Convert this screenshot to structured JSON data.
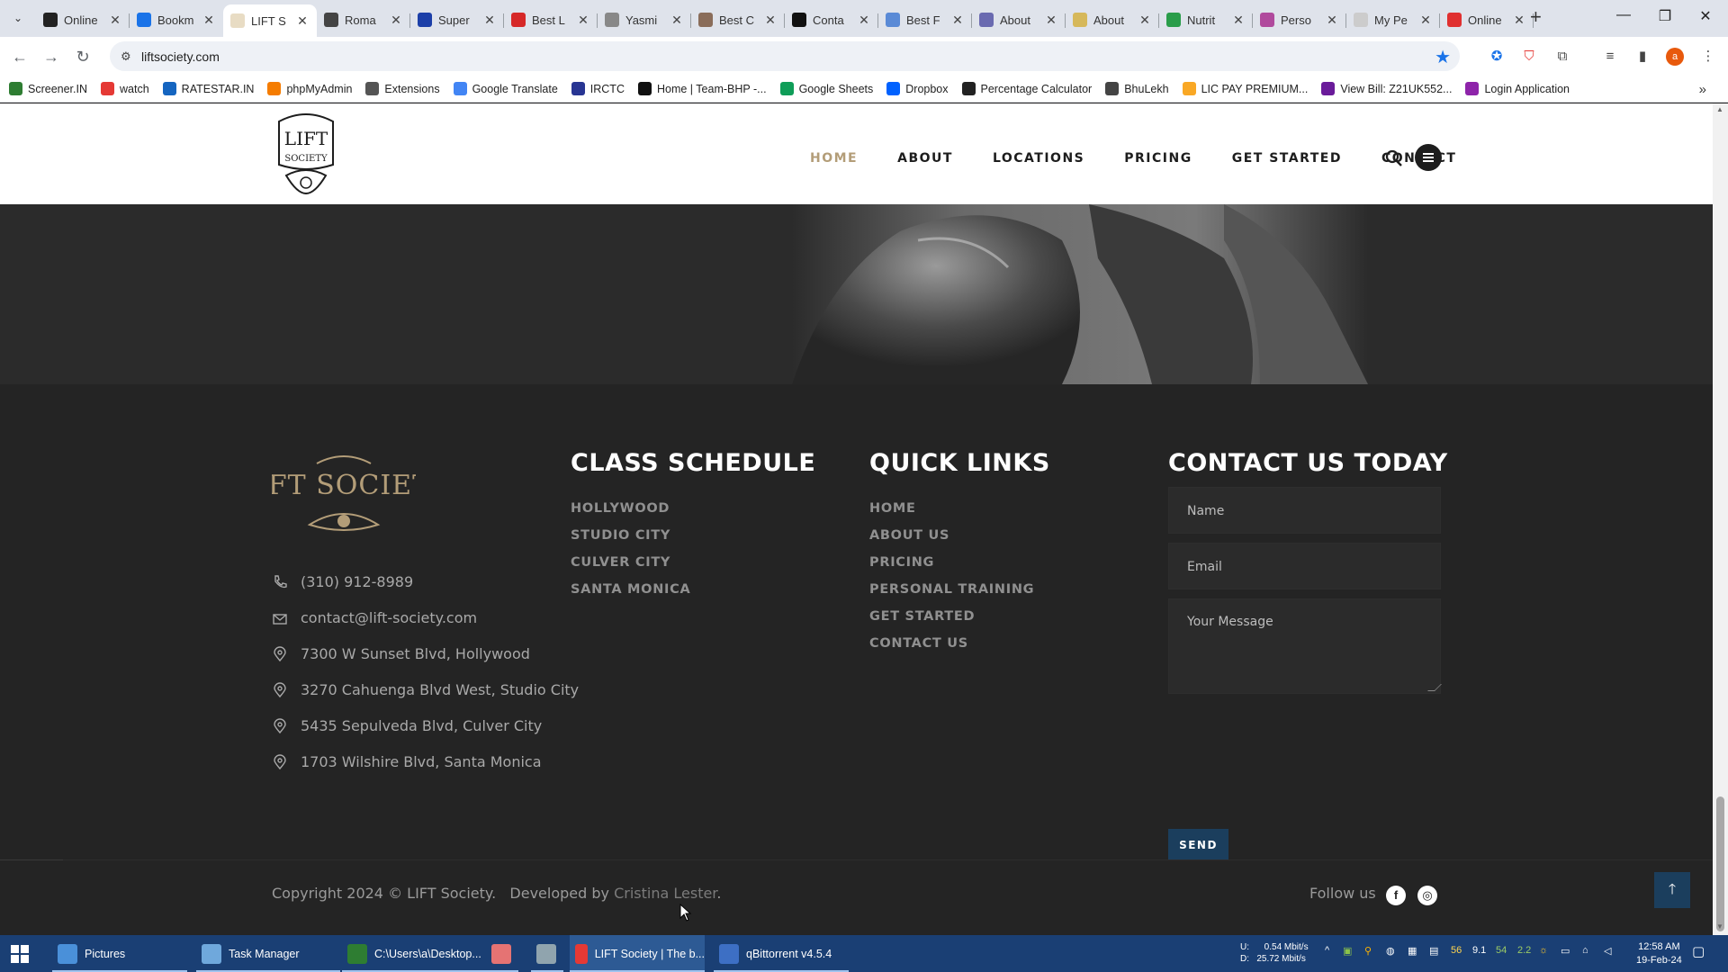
{
  "browser": {
    "tabs": [
      {
        "title": "Online",
        "color": "#222222"
      },
      {
        "title": "Bookm",
        "color": "#1a73e8"
      },
      {
        "title": "LIFT S",
        "color": "#e8dcc4"
      },
      {
        "title": "Roma",
        "color": "#444444"
      },
      {
        "title": "Super",
        "color": "#1c3fa8"
      },
      {
        "title": "Best L",
        "color": "#d62828"
      },
      {
        "title": "Yasmi",
        "color": "#888888"
      },
      {
        "title": "Best C",
        "color": "#8a6d5a"
      },
      {
        "title": "Conta",
        "color": "#111111"
      },
      {
        "title": "Best F",
        "color": "#5a8ad6"
      },
      {
        "title": "About",
        "color": "#6a6ab0"
      },
      {
        "title": "About",
        "color": "#d6b85a"
      },
      {
        "title": "Nutrit",
        "color": "#2a9d4a"
      },
      {
        "title": "Perso",
        "color": "#b04a9d"
      },
      {
        "title": "My Pe",
        "color": "#cccccc"
      },
      {
        "title": "Online",
        "color": "#e03030"
      }
    ],
    "url": "liftsociety.com",
    "bookmarks": [
      {
        "label": "Screener.IN",
        "color": "#2e7d32"
      },
      {
        "label": "watch",
        "color": "#e53935"
      },
      {
        "label": "RATESTAR.IN",
        "color": "#1565c0"
      },
      {
        "label": "phpMyAdmin",
        "color": "#f57c00"
      },
      {
        "label": "Extensions",
        "color": "#555555"
      },
      {
        "label": "Google Translate",
        "color": "#4285f4"
      },
      {
        "label": "IRCTC",
        "color": "#283593"
      },
      {
        "label": "Home | Team-BHP -...",
        "color": "#111111"
      },
      {
        "label": "Google Sheets",
        "color": "#0f9d58"
      },
      {
        "label": "Dropbox",
        "color": "#0061fe"
      },
      {
        "label": "Percentage Calculator",
        "color": "#222222"
      },
      {
        "label": "BhuLekh",
        "color": "#444444"
      },
      {
        "label": "LIC PAY PREMIUM...",
        "color": "#f9a825"
      },
      {
        "label": "View Bill: Z21UK552...",
        "color": "#6a1b9a"
      },
      {
        "label": "Login Application",
        "color": "#8e24aa"
      }
    ]
  },
  "site": {
    "nav": [
      {
        "label": "HOME",
        "current": true
      },
      {
        "label": "ABOUT",
        "current": false
      },
      {
        "label": "LOCATIONS",
        "current": false
      },
      {
        "label": "PRICING",
        "current": false
      },
      {
        "label": "GET STARTED",
        "current": false
      },
      {
        "label": "CONTACT",
        "current": false
      }
    ],
    "brand_color": "#b39d78",
    "accent_color": "#1b3e5d",
    "footer": {
      "contacts": [
        {
          "icon": "phone-icon",
          "text": "(310) 912-8989"
        },
        {
          "icon": "email-icon",
          "text": "contact@lift-society.com"
        },
        {
          "icon": "location-pin-icon",
          "text": "7300 W Sunset Blvd, Hollywood"
        },
        {
          "icon": "location-pin-icon",
          "text": "3270 Cahuenga Blvd West, Studio City"
        },
        {
          "icon": "location-pin-icon",
          "text": "5435 Sepulveda Blvd, Culver City"
        },
        {
          "icon": "location-pin-icon",
          "text": "1703 Wilshire Blvd, Santa Monica"
        }
      ],
      "class_schedule": {
        "title": "CLASS SCHEDULE",
        "links": [
          "HOLLYWOOD",
          "STUDIO CITY",
          "CULVER CITY",
          "SANTA MONICA"
        ]
      },
      "quick_links": {
        "title": "QUICK LINKS",
        "links": [
          "HOME",
          "ABOUT US",
          "PRICING",
          "PERSONAL TRAINING",
          "GET STARTED",
          "CONTACT US"
        ]
      },
      "contact_form": {
        "title": "CONTACT US TODAY",
        "name_placeholder": "Name",
        "email_placeholder": "Email",
        "message_placeholder": "Your Message",
        "send_label": "SEND"
      },
      "copyright": "Copyright 2024 © LIFT Society.",
      "developed_by_prefix": "Developed by",
      "developer": "Cristina Lester",
      "developer_suffix": ".",
      "follow_label": "Follow us",
      "social": [
        {
          "icon": "facebook-icon",
          "glyph": "f"
        },
        {
          "icon": "instagram-icon",
          "glyph": "◎"
        }
      ],
      "back_to_top_glyph": "🡑"
    }
  },
  "taskbar": {
    "apps": [
      {
        "label": "Pictures",
        "color": "#4a90d9",
        "active": false
      },
      {
        "label": "Task Manager",
        "color": "#6fa8dc",
        "active": false
      },
      {
        "label": "C:\\Users\\a\\Desktop...",
        "color": "#2e7d32",
        "active": false
      },
      {
        "label": "",
        "color": "#e57373",
        "active": false
      },
      {
        "label": "",
        "color": "#90a4ae",
        "active": false
      },
      {
        "label": "LIFT Society | The b...",
        "color": "#e53935",
        "active": true
      },
      {
        "label": "qBittorrent v4.5.4",
        "color": "#3d6fc4",
        "active": false
      }
    ],
    "net_up": "0.54 Mbit/s",
    "net_down": "25.72 Mbit/s",
    "net_up_label": "U:",
    "net_down_label": "D:",
    "tray_numbers": [
      "56",
      "9.1",
      "54",
      "2.2"
    ],
    "time": "12:58 AM",
    "date": "19-Feb-24"
  }
}
